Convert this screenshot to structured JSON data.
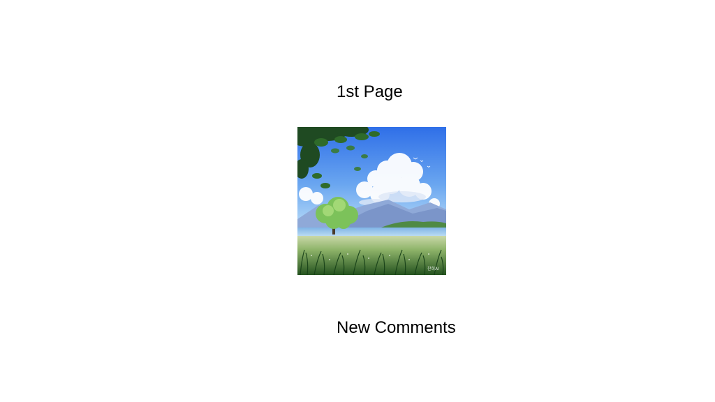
{
  "page": {
    "title": "1st Page",
    "comments_heading": "New Comments"
  },
  "image": {
    "name": "landscape-illustration",
    "watermark": "찬희AI"
  },
  "colors": {
    "background": "#ffffff",
    "text": "#000000",
    "sky_top": "#2f6fe8",
    "sky_bottom": "#8fc3f5",
    "grass": "#2f6b2a"
  }
}
